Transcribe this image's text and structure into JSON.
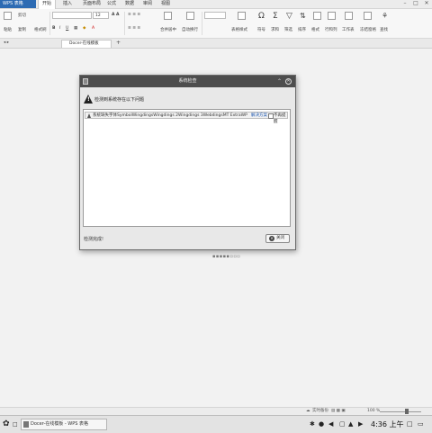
{
  "app": {
    "name": "WPS 表格",
    "tabs": [
      "开始",
      "插入",
      "页面布局",
      "公式",
      "数据",
      "审阅",
      "视图"
    ],
    "active_tab": "开始"
  },
  "ribbon": {
    "paste": "粘贴",
    "cut": "剪切",
    "copy": "复制",
    "format_painter": "格式刷",
    "font_size": "12",
    "merge_center": "合并居中",
    "wrap_text": "自动换行",
    "conditional_format": "表格样式",
    "symbol": "符号",
    "sum": "求和",
    "filter": "筛选",
    "sort": "排序",
    "format": "格式",
    "row_col": "行和列",
    "worksheet": "工作表",
    "freeze": "冻结窗格",
    "find": "查找"
  },
  "doc_tab": {
    "label": "Docer-在线模板",
    "add": "+"
  },
  "dialog": {
    "title": "系统检查",
    "heading": "检测到系统存在以下问题",
    "issue": {
      "text": "系统缺失字体SymbolWingdingsWingdings 2Wingdings 3WebdingsMT ExtraWPS...",
      "solution_link": "解决方案",
      "dont_show": "不再提醒"
    },
    "status": "检测完成!",
    "close_button": "关闭"
  },
  "pager": "▪▪▪▪▪▫▫▫",
  "statusbar": {
    "backup": "实时备份",
    "zoom": "100 %"
  },
  "taskbar": {
    "task_label": "Docer-在线模板 - WPS 表格",
    "clock": "4:36 上午"
  }
}
